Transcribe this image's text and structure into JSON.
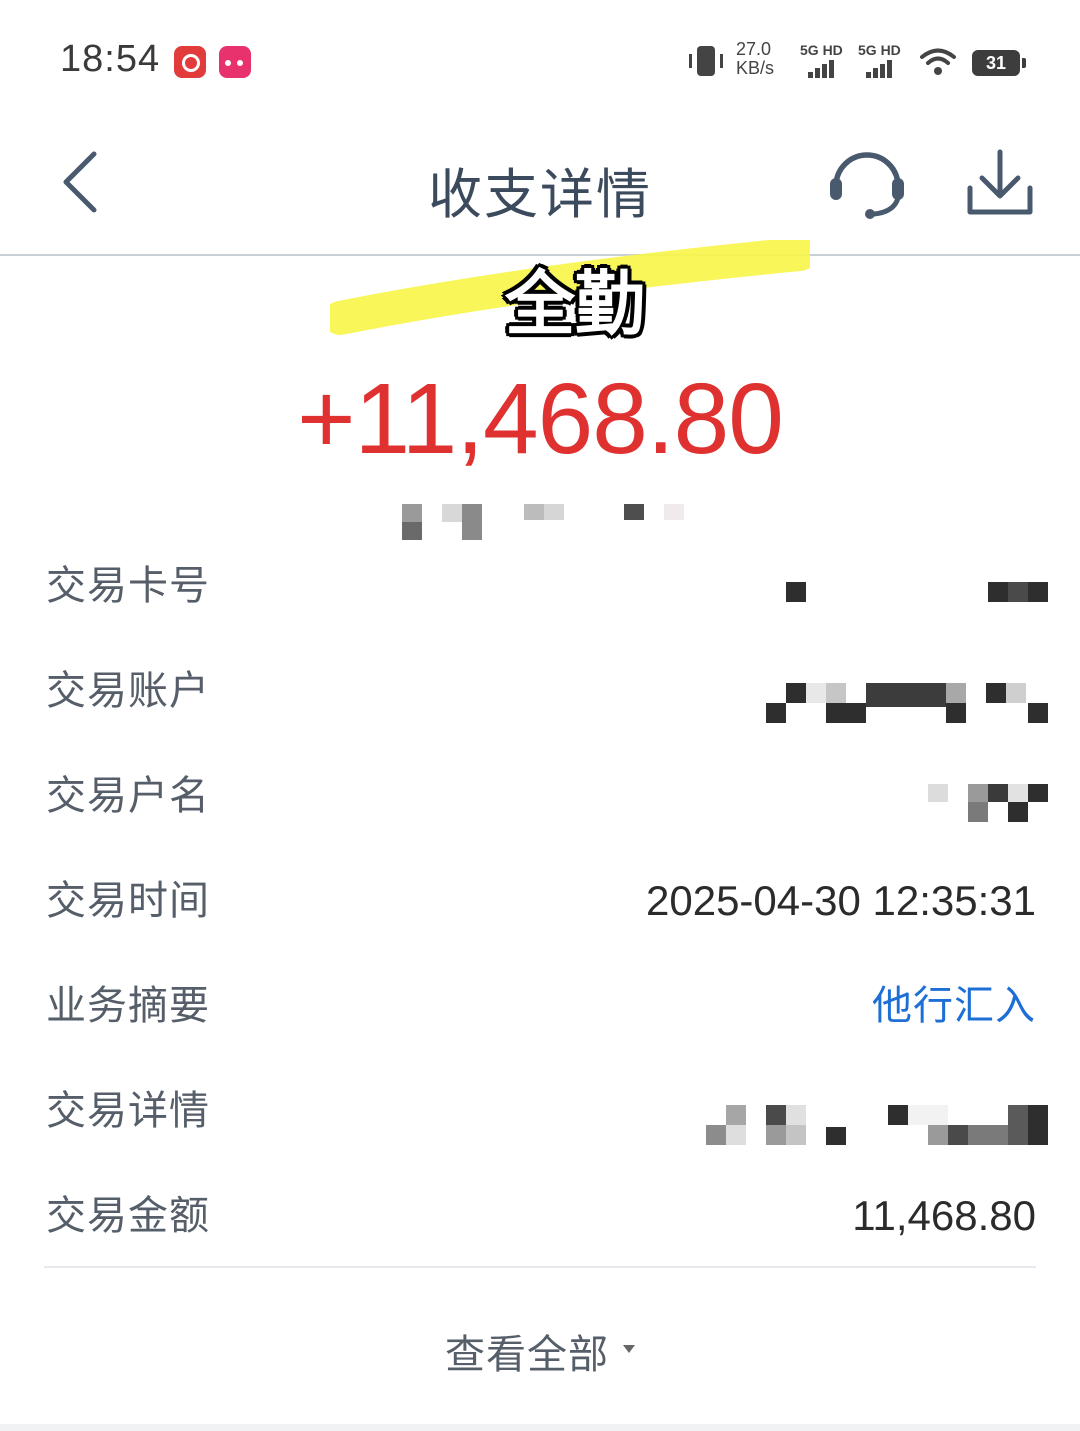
{
  "status_bar": {
    "time": "18:54",
    "net_speed_value": "27.0",
    "net_speed_unit": "KB/s",
    "signal_1_label": "5G HD",
    "signal_2_label": "5G HD",
    "battery_level": "31",
    "icons": [
      "netease-music-icon",
      "tmall-icon",
      "vibrate-icon",
      "wifi-icon",
      "battery-icon"
    ]
  },
  "nav": {
    "title": "收支详情",
    "back_icon": "chevron-left-icon",
    "support_icon": "headset-icon",
    "download_icon": "download-icon"
  },
  "sticker": {
    "text": "全勤",
    "highlight_color": "#f7f54a"
  },
  "transaction": {
    "amount": "+11,468.80",
    "amount_color": "#e03131"
  },
  "details": [
    {
      "label": "交易卡号",
      "value": ""
    },
    {
      "label": "交易账户",
      "value": ""
    },
    {
      "label": "交易户名",
      "value": ""
    },
    {
      "label": "交易时间",
      "value": "2025-04-30 12:35:31"
    },
    {
      "label": "业务摘要",
      "value": "他行汇入"
    },
    {
      "label": "交易详情",
      "value": ""
    },
    {
      "label": "交易金额",
      "value": "11,468.80"
    }
  ],
  "view_all": {
    "label": "查看全部"
  },
  "colors": {
    "label_text": "#555e69",
    "link": "#1d6fd6",
    "title": "#3b4a5c"
  }
}
